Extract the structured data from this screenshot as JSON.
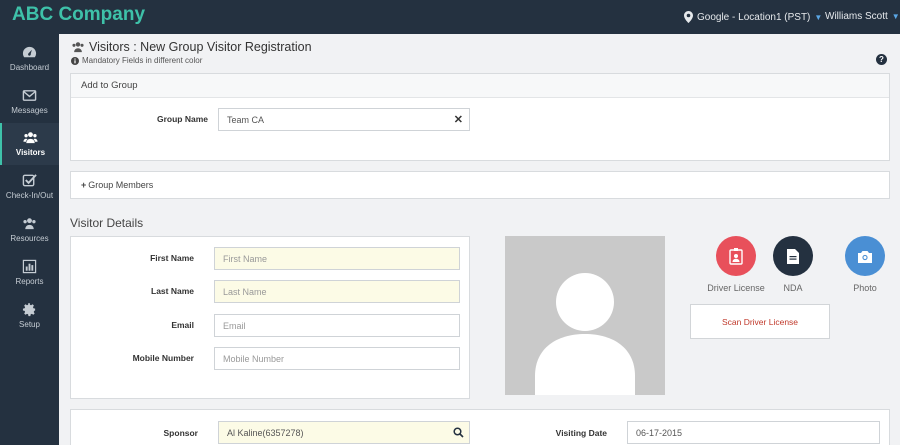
{
  "header": {
    "brand": "ABC Company",
    "location": "Google - Location1 (PST)",
    "user": "Williams Scott"
  },
  "sidebar": {
    "items": [
      {
        "label": "Dashboard",
        "icon": "dashboard-icon"
      },
      {
        "label": "Messages",
        "icon": "envelope-icon"
      },
      {
        "label": "Visitors",
        "icon": "users-icon",
        "active": true
      },
      {
        "label": "Check-In/Out",
        "icon": "checkbox-icon"
      },
      {
        "label": "Resources",
        "icon": "users-icon"
      },
      {
        "label": "Reports",
        "icon": "bar-chart-icon"
      },
      {
        "label": "Setup",
        "icon": "gear-icon"
      }
    ]
  },
  "page": {
    "title": "Visitors : New Group Visitor Registration",
    "subtitle": "Mandatory Fields in different color"
  },
  "group": {
    "panel_title": "Add to Group",
    "name_label": "Group Name",
    "name_value": "Team CA",
    "members_title": "Group Members"
  },
  "visitor": {
    "section_title": "Visitor Details",
    "first_name_label": "First Name",
    "first_name_placeholder": "First Name",
    "last_name_label": "Last Name",
    "last_name_placeholder": "Last Name",
    "email_label": "Email",
    "email_placeholder": "Email",
    "mobile_label": "Mobile Number",
    "mobile_placeholder": "Mobile Number"
  },
  "capture": {
    "driver_license_label": "Driver License",
    "nda_label": "NDA",
    "photo_label": "Photo",
    "scan_button": "Scan Driver License"
  },
  "visit": {
    "sponsor_label": "Sponsor",
    "sponsor_value": "Al Kaline(6357278)",
    "date_label": "Visiting Date",
    "date_value": "06-17-2015"
  },
  "colors": {
    "topbar": "#243140",
    "brand": "#3ec1a9",
    "driver_license_btn": "#e8505b",
    "nda_btn": "#243140",
    "photo_btn": "#4a8fd4",
    "scan_text": "#c0392b",
    "mandatory_bg": "#fcfbe6"
  }
}
